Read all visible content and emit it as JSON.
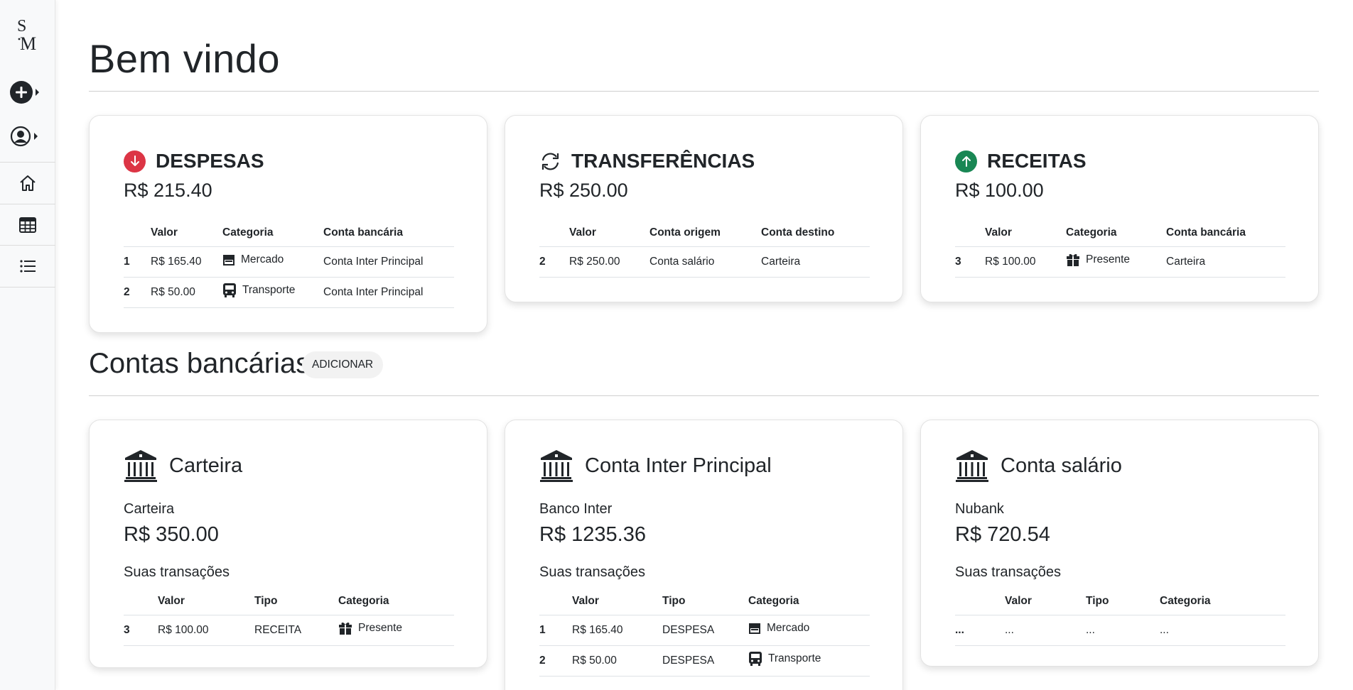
{
  "sidebar": {
    "logo_text_top": "S",
    "logo_text_bottom": "M"
  },
  "header": {
    "title": "Bem vindo"
  },
  "summary": {
    "despesas": {
      "title": "DESPESAS",
      "amount": "R$ 215.40",
      "color": "#dc3545",
      "columns": [
        "",
        "Valor",
        "Categoria",
        "Conta bancária"
      ],
      "rows": [
        {
          "idx": "1",
          "valor": "R$ 165.40",
          "icon": "store-icon",
          "categoria": "Mercado",
          "conta": "Conta Inter Principal"
        },
        {
          "idx": "2",
          "valor": "R$ 50.00",
          "icon": "bus-icon",
          "categoria": "Transporte",
          "conta": "Conta Inter Principal"
        }
      ]
    },
    "transferencias": {
      "title": "TRANSFERÊNCIAS",
      "amount": "R$ 250.00",
      "columns": [
        "",
        "Valor",
        "Conta origem",
        "Conta destino"
      ],
      "rows": [
        {
          "idx": "2",
          "valor": "R$ 250.00",
          "origem": "Conta salário",
          "destino": "Carteira"
        }
      ]
    },
    "receitas": {
      "title": "RECEITAS",
      "amount": "R$ 100.00",
      "color": "#198754",
      "columns": [
        "",
        "Valor",
        "Categoria",
        "Conta bancária"
      ],
      "rows": [
        {
          "idx": "3",
          "valor": "R$ 100.00",
          "icon": "gift-icon",
          "categoria": "Presente",
          "conta": "Carteira"
        }
      ]
    }
  },
  "accounts_section": {
    "title": "Contas bancárias",
    "add_label": "ADICIONAR"
  },
  "accounts": [
    {
      "name": "Carteira",
      "bank": "Carteira",
      "amount": "R$ 350.00",
      "tx_label": "Suas transações",
      "columns": [
        "",
        "Valor",
        "Tipo",
        "Categoria"
      ],
      "rows": [
        {
          "idx": "3",
          "valor": "R$ 100.00",
          "tipo": "RECEITA",
          "icon": "gift-icon",
          "categoria": "Presente"
        }
      ]
    },
    {
      "name": "Conta Inter Principal",
      "bank": "Banco Inter",
      "amount": "R$ 1235.36",
      "tx_label": "Suas transações",
      "columns": [
        "",
        "Valor",
        "Tipo",
        "Categoria"
      ],
      "rows": [
        {
          "idx": "1",
          "valor": "R$ 165.40",
          "tipo": "DESPESA",
          "icon": "store-icon",
          "categoria": "Mercado"
        },
        {
          "idx": "2",
          "valor": "R$ 50.00",
          "tipo": "DESPESA",
          "icon": "bus-icon",
          "categoria": "Transporte"
        }
      ]
    },
    {
      "name": "Conta salário",
      "bank": "Nubank",
      "amount": "R$ 720.54",
      "tx_label": "Suas transações",
      "columns": [
        "",
        "Valor",
        "Tipo",
        "Categoria"
      ],
      "rows": [
        {
          "idx": "...",
          "valor": "...",
          "tipo": "...",
          "categoria": "..."
        }
      ]
    }
  ]
}
